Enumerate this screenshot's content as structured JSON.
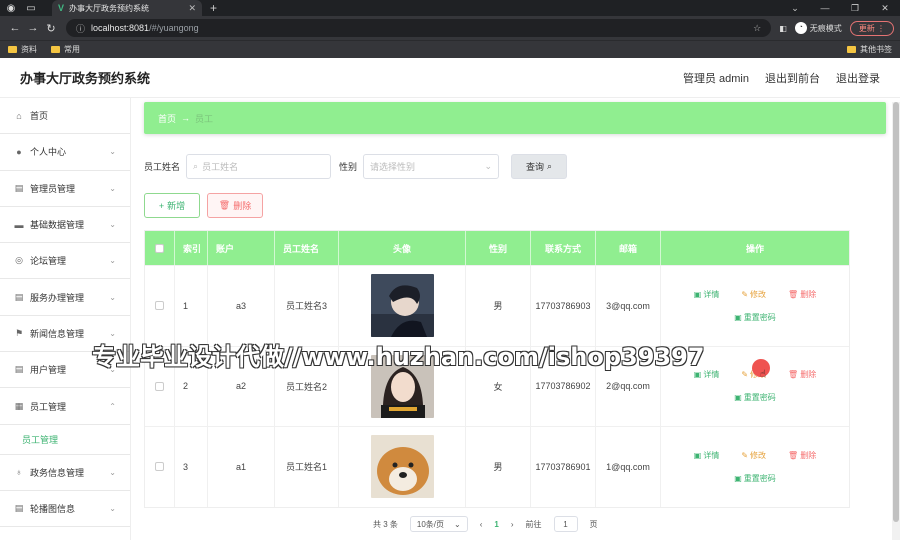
{
  "browser": {
    "tab_title": "办事大厅政务预约系统",
    "url_host": "localhost:8081",
    "url_path": "/#/yuangong",
    "incognito_label": "无痕模式",
    "update_label": "更新",
    "bookmarks": [
      "资料",
      "常用"
    ],
    "other_bookmarks": "其他书签"
  },
  "header": {
    "title": "办事大厅政务预约系统",
    "admin_label": "管理员 admin",
    "back_front": "退出到前台",
    "logout": "退出登录"
  },
  "sidebar": {
    "items": [
      {
        "label": "首页",
        "icon": "home-icon"
      },
      {
        "label": "个人中心",
        "icon": "user-icon"
      },
      {
        "label": "管理员管理",
        "icon": "clipboard-icon"
      },
      {
        "label": "基础数据管理",
        "icon": "monitor-icon"
      },
      {
        "label": "论坛管理",
        "icon": "compass-icon"
      },
      {
        "label": "服务办理管理",
        "icon": "clipboard-icon"
      },
      {
        "label": "新闻信息管理",
        "icon": "flag-icon"
      },
      {
        "label": "用户管理",
        "icon": "clipboard-icon"
      },
      {
        "label": "员工管理",
        "icon": "grid-icon"
      },
      {
        "label": "政务信息管理",
        "icon": "mic-icon"
      },
      {
        "label": "轮播图信息",
        "icon": "clipboard-icon"
      }
    ],
    "active_sub": "员工管理"
  },
  "breadcrumb": {
    "home": "首页",
    "arrow": "→",
    "current": "员工"
  },
  "search": {
    "name_label": "员工姓名",
    "name_placeholder": "员工姓名",
    "gender_label": "性别",
    "gender_placeholder": "请选择性别",
    "query_label": "查询"
  },
  "actions": {
    "add": "新增",
    "delete": "删除"
  },
  "table": {
    "headers": [
      "索引",
      "账户",
      "员工姓名",
      "头像",
      "性别",
      "联系方式",
      "邮箱",
      "操作"
    ],
    "rows": [
      {
        "index": "1",
        "account": "a3",
        "name": "员工姓名3",
        "gender": "男",
        "phone": "17703786903",
        "email": "3@qq.com"
      },
      {
        "index": "2",
        "account": "a2",
        "name": "员工姓名2",
        "gender": "女",
        "phone": "17703786902",
        "email": "2@qq.com"
      },
      {
        "index": "3",
        "account": "a1",
        "name": "员工姓名1",
        "gender": "男",
        "phone": "17703786901",
        "email": "1@qq.com"
      }
    ],
    "ops": {
      "detail": "详情",
      "edit": "修改",
      "remove": "删除",
      "reset": "重置密码"
    }
  },
  "pager": {
    "total": "共 3 条",
    "size": "10条/页",
    "current": "1",
    "goto": "前往",
    "goto_value": "1",
    "page": "页"
  },
  "watermark": "专业毕业设计代做//www.huzhan.com/ishop39397",
  "colors": {
    "accent": "#90ee90",
    "green_text": "#3cb371",
    "danger": "#f56c6c",
    "warning": "#e6a23c"
  }
}
